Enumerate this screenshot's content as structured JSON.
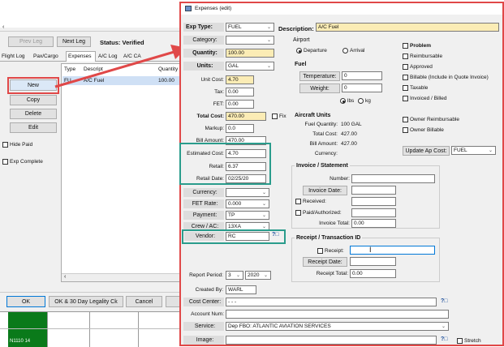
{
  "left_panel": {
    "prev_leg": "Prev Leg",
    "next_leg": "Next Leg",
    "status": "Status: Verified",
    "tabs": [
      "Flight Log",
      "Pax/Cargo",
      "Expenses",
      "A/C Log",
      "A/C CA"
    ],
    "columns": [
      "Type",
      "Descript",
      "Quantity"
    ],
    "rows": [
      {
        "type": "FU",
        "desc": "A/C Fuel",
        "qty": "100.00"
      }
    ],
    "new": "New",
    "copy": "Copy",
    "delete": "Delete",
    "edit": "Edit",
    "hide_paid": "Hide Paid",
    "exp_complete": "Exp Complete",
    "ok": "OK",
    "ok_legality": "OK & 30 Day Legality Ck",
    "cancel": "Cancel",
    "bottom_label": "N1110 14"
  },
  "dialog": {
    "title": "Expenses (edit)",
    "exp_type_label": "Exp Type:",
    "exp_type": "FUEL",
    "description_label": "Description:",
    "description": "A/C Fuel",
    "category_label": "Category:",
    "quantity_label": "Quantity:",
    "quantity": "100.00",
    "units_label": "Units:",
    "units": "GAL",
    "unit_cost_label": "Unit Cost:",
    "unit_cost": "4.70",
    "tax_label": "Tax:",
    "tax": "0.00",
    "fet_label": "FET:",
    "fet": "0.00",
    "total_cost_label": "Total Cost:",
    "total_cost": "470.00",
    "fix_label": "Fix",
    "markup_label": "Markup:",
    "markup": "0.0",
    "bill_amount_label": "Bill Amount:",
    "bill_amount": "470.00",
    "estimated_cost_label": "Estimated Cost:",
    "estimated_cost": "4.70",
    "retail_label": "Retail:",
    "retail": "6.37",
    "retail_date_label": "Retail Date:",
    "retail_date": "02/25/20",
    "currency_label": "Currency:",
    "fet_rate_label": "FET Rate:",
    "fet_rate": "0.000",
    "payment_label": "Payment:",
    "payment": "TP",
    "crew_ac_label": "Crew / AC:",
    "crew_ac": "13XA",
    "vendor_label": "Vendor:",
    "vendor": "RC",
    "help_q": "?",
    "report_period_label": "Report Period:",
    "report_month": "3",
    "report_year": "2020",
    "created_by_label": "Created By:",
    "created_by": "WARL",
    "cost_center_label": "Cost Center:",
    "cost_center": "-   -   -",
    "account_num_label": "Account Num:",
    "service_label": "Service:",
    "service": "Dep FBO: ATLANTIC AVIATION SERVICES",
    "image_label": "Image:",
    "stretch_label": "Stretch",
    "airport": {
      "title": "Airport",
      "departure": "Departure",
      "arrival": "Arrival"
    },
    "fuel": {
      "title": "Fuel",
      "temperature_label": "Temperature:",
      "temperature": "0",
      "weight_label": "Weight:",
      "weight": "0",
      "lbs": "lbs",
      "kg": "kg"
    },
    "aircraft_units": {
      "title": "Aircraft Units",
      "fuel_quantity": "Fuel Quantity:",
      "fuel_quantity_val": "100 GAL",
      "total_cost": "Total Cost:",
      "total_cost_val": "427.00",
      "bill_amount": "Bill Amount:",
      "bill_amount_val": "427.00",
      "currency": "Currency:"
    },
    "flags": [
      {
        "label": "Problem",
        "bold": true
      },
      {
        "label": "Reimbursable"
      },
      {
        "label": "Approved"
      },
      {
        "label": "Billable (Include in Quote Invoice)"
      },
      {
        "label": "Taxable"
      },
      {
        "label": "Invoiced / Billed"
      }
    ],
    "owner_flags": [
      "Owner Reimbursable",
      "Owner Billable"
    ],
    "update_ap_cost_label": "Update Ap Cost:",
    "update_ap_cost": "FUEL",
    "invoice": {
      "title": "Invoice / Statement",
      "number_label": "Number:",
      "invoice_date_label": "Invoice Date:",
      "received_label": "Received:",
      "paid_label": "Paid/Authorized:",
      "invoice_total_label": "Invoice Total:",
      "invoice_total": "0.00"
    },
    "receipt": {
      "title": "Receipt / Transaction ID",
      "receipt_label": "Receipt:",
      "receipt_date_label": "Receipt Date:",
      "receipt_total_label": "Receipt Total:",
      "receipt_total": "0.00"
    }
  }
}
